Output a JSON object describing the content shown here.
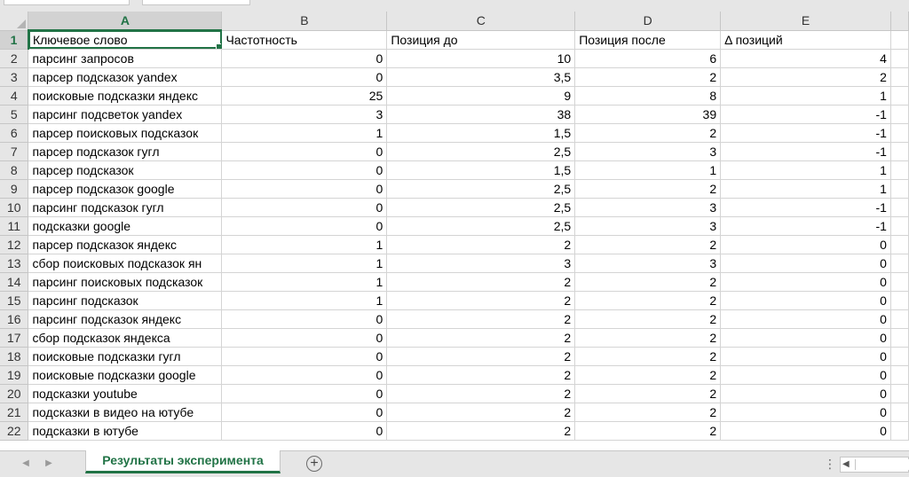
{
  "columns": [
    "A",
    "B",
    "C",
    "D",
    "E"
  ],
  "selected_column": "A",
  "selected_row": "1",
  "header_row": {
    "row": "1",
    "a": "Ключевое слово",
    "b": "Частотность",
    "c": "Позиция до",
    "d": "Позиция после",
    "e": "Δ позиций"
  },
  "rows": [
    {
      "row": "2",
      "a": "парсинг запросов",
      "b": "0",
      "c": "10",
      "d": "6",
      "e": "4"
    },
    {
      "row": "3",
      "a": "парсер подсказок yandex",
      "b": "0",
      "c": "3,5",
      "d": "2",
      "e": "2"
    },
    {
      "row": "4",
      "a": "поисковые подсказки яндекс",
      "b": "25",
      "c": "9",
      "d": "8",
      "e": "1"
    },
    {
      "row": "5",
      "a": "парсинг подсветок yandex",
      "b": "3",
      "c": "38",
      "d": "39",
      "e": "-1"
    },
    {
      "row": "6",
      "a": "парсер поисковых подсказок",
      "b": "1",
      "c": "1,5",
      "d": "2",
      "e": "-1"
    },
    {
      "row": "7",
      "a": "парсер подсказок гугл",
      "b": "0",
      "c": "2,5",
      "d": "3",
      "e": "-1"
    },
    {
      "row": "8",
      "a": "парсер подсказок",
      "b": "0",
      "c": "1,5",
      "d": "1",
      "e": "1"
    },
    {
      "row": "9",
      "a": "парсер подсказок google",
      "b": "0",
      "c": "2,5",
      "d": "2",
      "e": "1"
    },
    {
      "row": "10",
      "a": "парсинг подсказок гугл",
      "b": "0",
      "c": "2,5",
      "d": "3",
      "e": "-1"
    },
    {
      "row": "11",
      "a": "подсказки google",
      "b": "0",
      "c": "2,5",
      "d": "3",
      "e": "-1"
    },
    {
      "row": "12",
      "a": "парсер подсказок яндекс",
      "b": "1",
      "c": "2",
      "d": "2",
      "e": "0"
    },
    {
      "row": "13",
      "a": "сбор поисковых подсказок ян",
      "b": "1",
      "c": "3",
      "d": "3",
      "e": "0"
    },
    {
      "row": "14",
      "a": "парсинг поисковых подсказок",
      "b": "1",
      "c": "2",
      "d": "2",
      "e": "0"
    },
    {
      "row": "15",
      "a": "парсинг подсказок",
      "b": "1",
      "c": "2",
      "d": "2",
      "e": "0"
    },
    {
      "row": "16",
      "a": "парсинг подсказок яндекс",
      "b": "0",
      "c": "2",
      "d": "2",
      "e": "0"
    },
    {
      "row": "17",
      "a": "сбор подсказок яндекса",
      "b": "0",
      "c": "2",
      "d": "2",
      "e": "0"
    },
    {
      "row": "18",
      "a": "поисковые подсказки гугл",
      "b": "0",
      "c": "2",
      "d": "2",
      "e": "0"
    },
    {
      "row": "19",
      "a": "поисковые подсказки google",
      "b": "0",
      "c": "2",
      "d": "2",
      "e": "0"
    },
    {
      "row": "20",
      "a": "подсказки youtube",
      "b": "0",
      "c": "2",
      "d": "2",
      "e": "0"
    },
    {
      "row": "21",
      "a": "подсказки в видео на ютубе",
      "b": "0",
      "c": "2",
      "d": "2",
      "e": "0"
    },
    {
      "row": "22",
      "a": "подсказки в ютубе",
      "b": "0",
      "c": "2",
      "d": "2",
      "e": "0"
    }
  ],
  "sheet_tab": "Результаты эксперимента",
  "icons": {
    "add_sheet": "+",
    "more_options": "⋮",
    "nav_prev": "◀",
    "nav_next": "▶",
    "scroll_left": "◀"
  },
  "colors": {
    "accent": "#217346",
    "header_bg": "#e6e6e6",
    "grid_line": "#d4d4d4"
  }
}
